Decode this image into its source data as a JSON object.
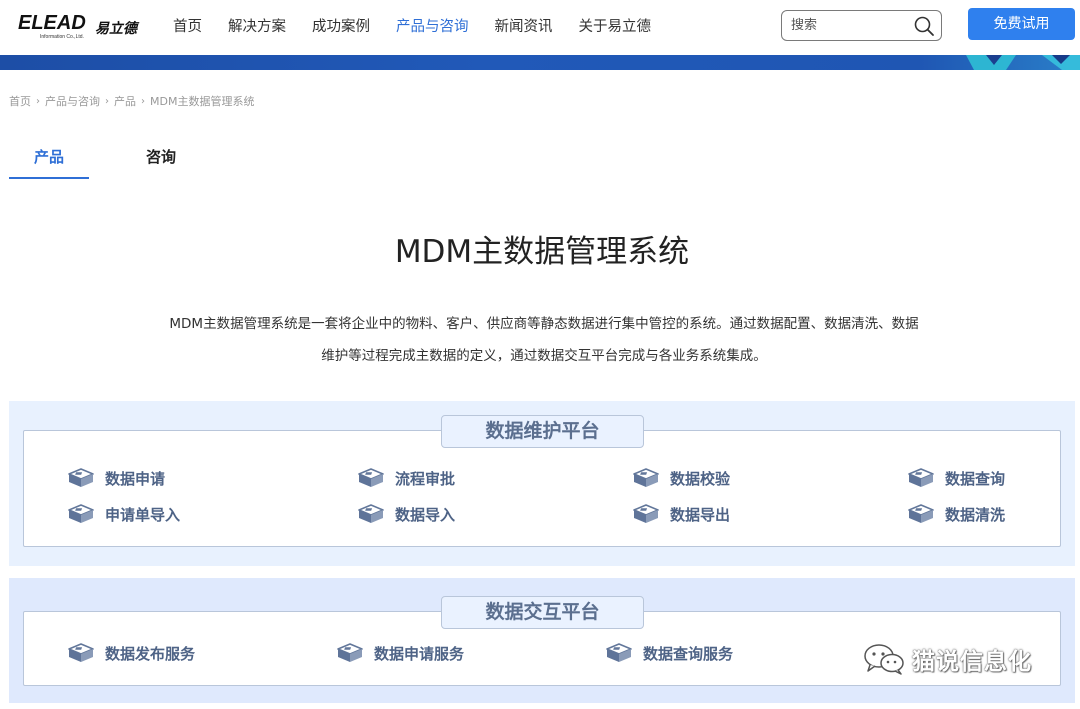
{
  "header": {
    "logo_en": "ELEAD",
    "logo_cn": "易立德",
    "logo_sub": "Information Co.,Ltd.",
    "nav": [
      "首页",
      "解决方案",
      "成功案例",
      "产品与咨询",
      "新闻资讯",
      "关于易立德"
    ],
    "nav_active_index": 3,
    "search_placeholder": "搜索",
    "trial_button": "免费试用"
  },
  "breadcrumb": [
    "首页",
    "产品与咨询",
    "产品",
    "MDM主数据管理系统"
  ],
  "tabs": [
    "产品",
    "咨询"
  ],
  "active_tab_index": 0,
  "main": {
    "title": "MDM主数据管理系统",
    "desc_line1": "MDM主数据管理系统是一套将企业中的物料、客户、供应商等静态数据进行集中管控的系统。通过数据配置、数据清洗、数据",
    "desc_line2": "维护等过程完成主数据的定义，通过数据交互平台完成与各业务系统集成。"
  },
  "platform1": {
    "title": "数据维护平台",
    "items": [
      "数据申请",
      "流程审批",
      "数据校验",
      "数据查询",
      "申请单导入",
      "数据导入",
      "数据导出",
      "数据清洗"
    ]
  },
  "platform2": {
    "title": "数据交互平台",
    "items": [
      "数据发布服务",
      "数据申请服务",
      "数据查询服务"
    ]
  },
  "watermark": "猫说信息化",
  "colors": {
    "accent": "#2f6fd6",
    "button": "#2f80ee",
    "banner": "#1f56b3",
    "panel_bg": "#e8f1fe",
    "feature_text": "#4e6386"
  },
  "icons": {
    "search": "search-icon",
    "feature": "data-cube-icon",
    "watermark": "wechat-icon"
  }
}
